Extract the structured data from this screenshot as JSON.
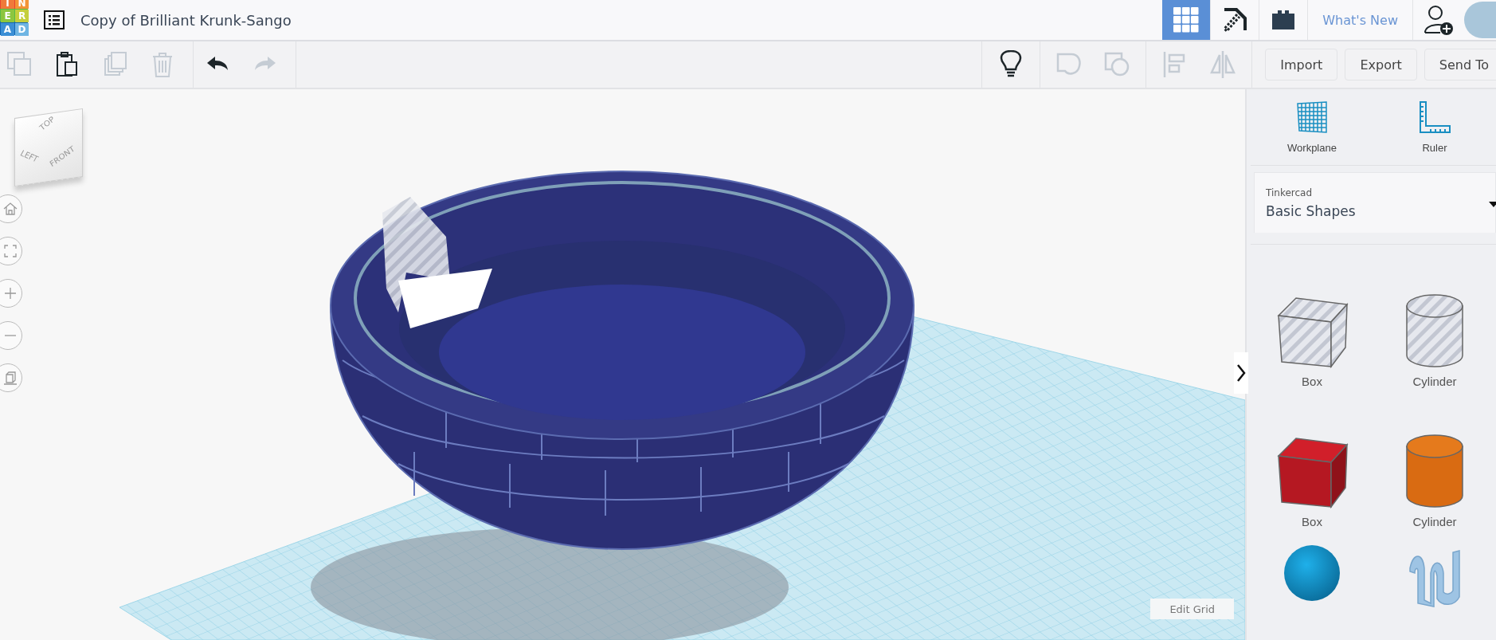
{
  "logo": {
    "tiles": [
      {
        "letter": "I",
        "color": "#f0793a"
      },
      {
        "letter": "N",
        "color": "#f39436"
      },
      {
        "letter": "E",
        "color": "#8cc63f"
      },
      {
        "letter": "R",
        "color": "#c4cf3c"
      },
      {
        "letter": "A",
        "color": "#3b8fd6"
      },
      {
        "letter": "D",
        "color": "#6fb5e3"
      }
    ]
  },
  "document": {
    "title": "Copy of Brilliant Krunk-Sango"
  },
  "view_modes": [
    {
      "kind": "grid",
      "selected": true
    },
    {
      "kind": "pickaxe",
      "selected": false
    },
    {
      "kind": "bricks",
      "selected": false
    }
  ],
  "whats_new": "What's New",
  "toolbar": {
    "left": [
      {
        "kind": "copy",
        "disabled": true
      },
      {
        "kind": "paste",
        "disabled": false
      },
      {
        "kind": "duplicate",
        "disabled": true
      },
      {
        "kind": "delete",
        "disabled": true
      },
      {
        "kind": "undo",
        "disabled": false
      },
      {
        "kind": "redo",
        "disabled": true
      }
    ],
    "right": [
      {
        "kind": "bulb",
        "disabled": false
      },
      {
        "kind": "group",
        "disabled": true
      },
      {
        "kind": "hole",
        "disabled": true
      },
      {
        "kind": "align",
        "disabled": true
      },
      {
        "kind": "mirror",
        "disabled": true
      }
    ],
    "buttons": [
      "Import",
      "Export",
      "Send To"
    ]
  },
  "view_cube": {
    "faces": [
      "TOP",
      "LEFT",
      "FRONT"
    ]
  },
  "nav_buttons": [
    {
      "kind": "home"
    },
    {
      "kind": "fit"
    },
    {
      "kind": "zoom-in"
    },
    {
      "kind": "zoom-out"
    },
    {
      "kind": "perspective"
    }
  ],
  "edit_grid": "Edit Grid",
  "panel": {
    "tools": [
      {
        "kind": "workplane",
        "label": "Workplane"
      },
      {
        "kind": "ruler",
        "label": "Ruler"
      }
    ],
    "library": {
      "caption": "Tinkercad",
      "value": "Basic Shapes"
    },
    "shapes": [
      {
        "kind": "striped-box",
        "label": "Box"
      },
      {
        "kind": "striped-cylinder",
        "label": "Cylinder"
      },
      {
        "kind": "box",
        "label": "Box"
      },
      {
        "kind": "cylinder",
        "label": "Cylinder"
      },
      {
        "kind": "sphere"
      },
      {
        "kind": "scribble"
      }
    ]
  }
}
